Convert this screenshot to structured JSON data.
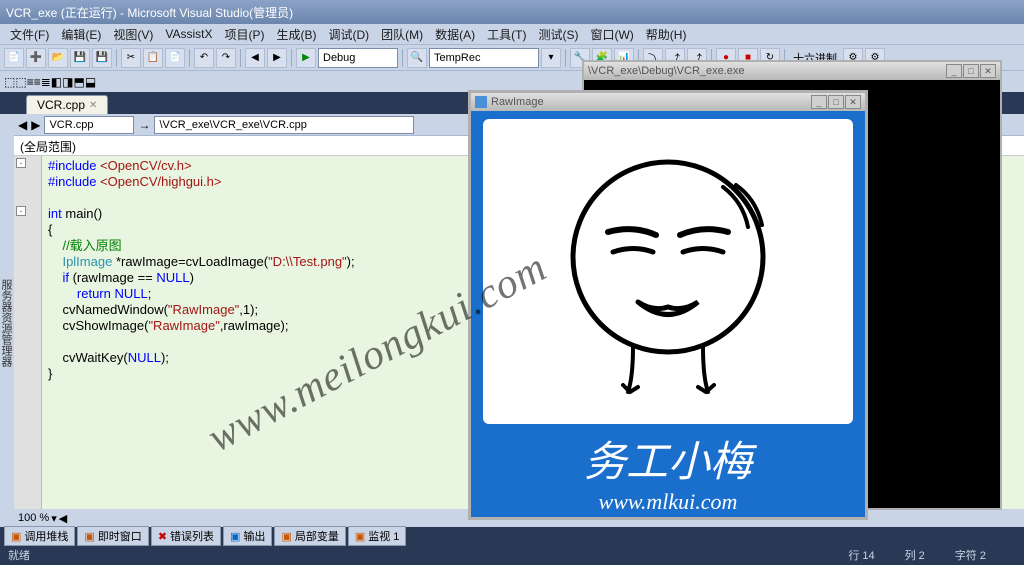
{
  "title": "VCR_exe (正在运行) - Microsoft Visual Studio(管理员)",
  "menus": [
    "文件(F)",
    "编辑(E)",
    "视图(V)",
    "VAssistX",
    "项目(P)",
    "生成(B)",
    "调试(D)",
    "团队(M)",
    "数据(A)",
    "工具(T)",
    "测试(S)",
    "窗口(W)",
    "帮助(H)"
  ],
  "config_combo": "Debug",
  "target_combo": "TempRec",
  "hex_label": "十六进制",
  "tab": {
    "name": "VCR.cpp"
  },
  "nav": {
    "file": "VCR.cpp",
    "path": "\\VCR_exe\\VCR_exe\\VCR.cpp"
  },
  "scope": "(全局范围)",
  "code": {
    "l1": "#include <OpenCV/cv.h>",
    "l2": "#include <OpenCV/highgui.h>",
    "l3": "",
    "l4": "int main()",
    "l5": "{",
    "l6": "    //载入原图",
    "l7": "    IplImage *rawImage=cvLoadImage(\"D:\\\\Test.png\");",
    "l8": "    if (rawImage == NULL)",
    "l9": "        return NULL;",
    "l10": "    cvNamedWindow(\"RawImage\",1);",
    "l11": "    cvShowImage(\"RawImage\",rawImage);",
    "l12": "",
    "l13": "    cvWaitKey(NULL);",
    "l14": "}"
  },
  "zoom": "100 %",
  "bottom_tabs": [
    "调用堆栈",
    "即时窗口",
    "错误列表",
    "输出",
    "局部变量",
    "监视 1"
  ],
  "status": {
    "state": "就绪",
    "line": "行 14",
    "col": "列 2",
    "char": "字符 2"
  },
  "console": {
    "title": "\\VCR_exe\\Debug\\VCR_exe.exe"
  },
  "imgwin": {
    "title": "RawImage",
    "caption_big": "务工小梅",
    "caption_url": "www.mlkui.com"
  },
  "watermark": "www.meilongkui.com",
  "sidebar_label": "服务器资源管理器"
}
